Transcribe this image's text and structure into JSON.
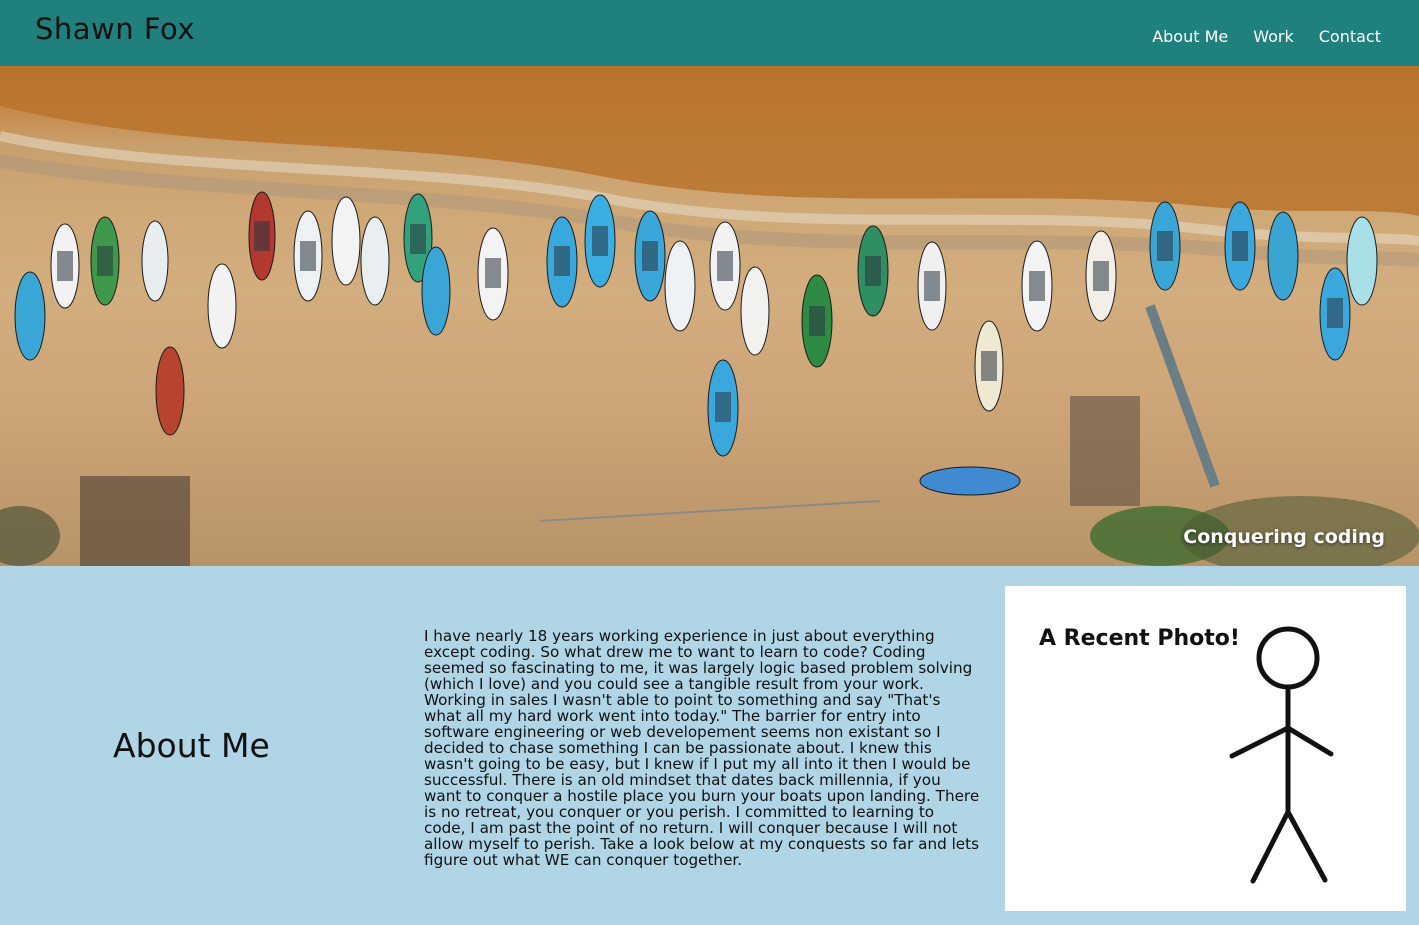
{
  "header": {
    "brand": "Shawn Fox",
    "nav": [
      {
        "label": "About Me"
      },
      {
        "label": "Work"
      },
      {
        "label": "Contact"
      }
    ],
    "background_color": "#20807e"
  },
  "hero": {
    "caption": "Conquering coding",
    "image_icon": "beach-boats-aerial-image"
  },
  "about": {
    "title": "About Me",
    "text": "I have nearly 18 years working experience in just about everything except coding. So what drew me to want to learn to code? Coding seemed so fascinating to me, it was largely logic based problem solving (which I love) and you could see a tangible result from your work. Working in sales I wasn't able to point to something and say \"That's what all my hard work went into today.\" The barrier for entry into software engineering or web developement seems non existant so I decided to chase something I can be passionate about. I knew this wasn't going to be easy, but I knew if I put my all into it then I would be successful. There is an old mindset that dates back millennia, if you want to conquer a hostile place you burn your boats upon landing. There is no retreat, you conquer or you perish. I committed to learning to code, I am past the point of no return. I will conquer because I will not allow myself to perish. Take a look below at my conquests so far and lets figure out what WE can conquer together.",
    "background_color": "#b0d5e6",
    "photo_card": {
      "heading": "A Recent Photo!",
      "image_icon": "stick-figure-icon"
    }
  }
}
